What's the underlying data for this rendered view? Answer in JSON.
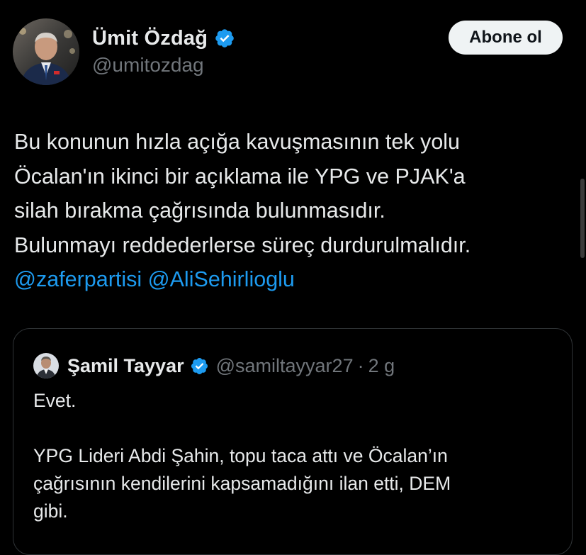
{
  "author": {
    "display_name": "Ümit Özdağ",
    "handle": "@umitozdag",
    "verified": true,
    "avatar_icon": "profile-photo-icon"
  },
  "actions": {
    "follow_label": "Abone ol"
  },
  "tweet": {
    "lines": [
      "Bu konunun hızla açığa kavuşmasının tek yolu",
      "Öcalan'ın ikinci bir açıklama ile YPG ve PJAK'a",
      "silah bırakma çağrısında bulunmasıdır.",
      "Bulunmayı reddederlerse süreç durdurulmalıdır."
    ],
    "mentions": [
      "@zaferpartisi",
      "@AliSehirlioglu"
    ]
  },
  "quote": {
    "display_name": "Şamil Tayyar",
    "handle": "@samiltayyar27",
    "separator": "·",
    "time": "2 g",
    "verified": true,
    "paragraph1": "Evet.",
    "lines": [
      "YPG Lideri Abdi Şahin, topu taca attı ve Öcalan’ın",
      "çağrısının kendilerini kapsamadığını ilan etti, DEM",
      "gibi."
    ]
  },
  "colors": {
    "background": "#000000",
    "text": "#e7e9ea",
    "secondary_text": "#71767b",
    "link": "#1d9bf0",
    "verified_badge": "#1d9bf0",
    "border": "#2f3336",
    "button_bg": "#eff3f4"
  }
}
